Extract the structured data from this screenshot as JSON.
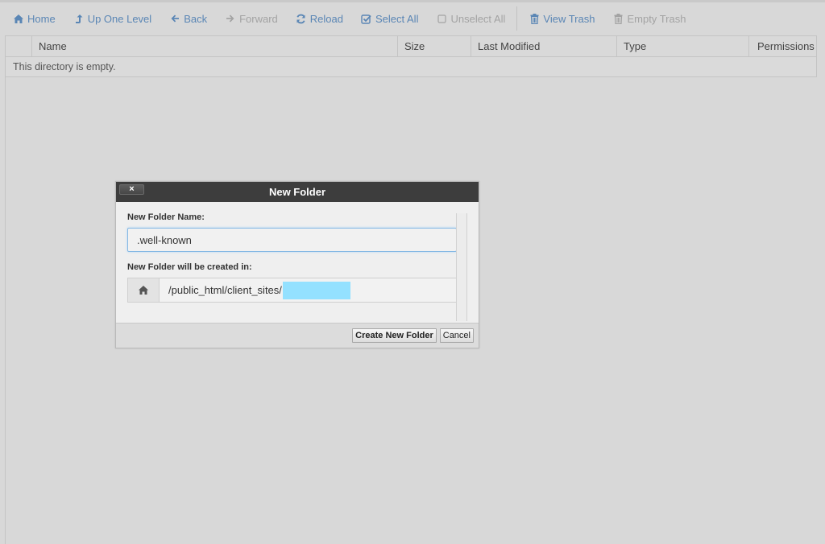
{
  "toolbar": {
    "home": {
      "label": "Home",
      "icon": "home-icon",
      "enabled": true
    },
    "up": {
      "label": "Up One Level",
      "icon": "level-up-icon",
      "enabled": true
    },
    "back": {
      "label": "Back",
      "icon": "arrow-left-icon",
      "enabled": true
    },
    "forward": {
      "label": "Forward",
      "icon": "arrow-right-icon",
      "enabled": false
    },
    "reload": {
      "label": "Reload",
      "icon": "refresh-icon",
      "enabled": true
    },
    "select_all": {
      "label": "Select All",
      "icon": "check-square-icon",
      "enabled": true
    },
    "unselect_all": {
      "label": "Unselect All",
      "icon": "square-icon",
      "enabled": false
    },
    "view_trash": {
      "label": "View Trash",
      "icon": "trash-icon",
      "enabled": true
    },
    "empty_trash": {
      "label": "Empty Trash",
      "icon": "trash-icon",
      "enabled": false
    }
  },
  "table": {
    "columns": [
      "Name",
      "Size",
      "Last Modified",
      "Type",
      "Permissions"
    ],
    "empty_message": "This directory is empty."
  },
  "dialog": {
    "title": "New Folder",
    "close_label": "×",
    "name_label": "New Folder Name:",
    "name_value": ".well-known",
    "location_label": "New Folder will be created in:",
    "location_path": "/public_html/client_sites/",
    "create_button": "Create New Folder",
    "cancel_button": "Cancel"
  },
  "colors": {
    "link": "#5a86b5",
    "disabled": "#a3a3a3",
    "dialog_title_bg": "#3d3d3d",
    "focus_border": "#84b8e4",
    "redaction": "#94e1ff"
  }
}
